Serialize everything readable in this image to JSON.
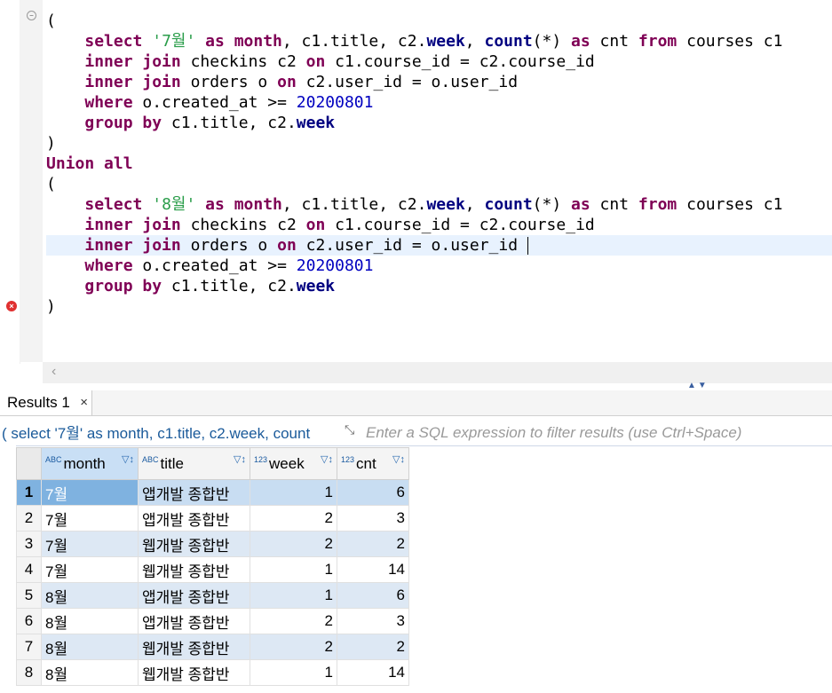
{
  "editor": {
    "lines": [
      {
        "parts": [
          [
            "p",
            "("
          ]
        ]
      },
      {
        "parts": [
          [
            "p",
            "    "
          ],
          [
            "kw",
            "select"
          ],
          [
            "p",
            " "
          ],
          [
            "str",
            "'7월'"
          ],
          [
            "p",
            " "
          ],
          [
            "kw",
            "as"
          ],
          [
            "p",
            " "
          ],
          [
            "kw",
            "month"
          ],
          [
            "p",
            ", c1.title, c2."
          ],
          [
            "fn",
            "week"
          ],
          [
            "p",
            ", "
          ],
          [
            "fn",
            "count"
          ],
          [
            "p",
            "(*) "
          ],
          [
            "kw",
            "as"
          ],
          [
            "p",
            " cnt "
          ],
          [
            "kw",
            "from"
          ],
          [
            "p",
            " courses c1"
          ]
        ]
      },
      {
        "parts": [
          [
            "p",
            "    "
          ],
          [
            "kw",
            "inner join"
          ],
          [
            "p",
            " checkins c2 "
          ],
          [
            "kw",
            "on"
          ],
          [
            "p",
            " c1.course_id = c2.course_id"
          ]
        ]
      },
      {
        "parts": [
          [
            "p",
            "    "
          ],
          [
            "kw",
            "inner join"
          ],
          [
            "p",
            " orders o "
          ],
          [
            "kw",
            "on"
          ],
          [
            "p",
            " c2.user_id = o.user_id"
          ]
        ]
      },
      {
        "parts": [
          [
            "p",
            "    "
          ],
          [
            "kw",
            "where"
          ],
          [
            "p",
            " o.created_at >= "
          ],
          [
            "num",
            "20200801"
          ]
        ]
      },
      {
        "parts": [
          [
            "p",
            "    "
          ],
          [
            "kw",
            "group by"
          ],
          [
            "p",
            " c1.title, c2."
          ],
          [
            "fn",
            "week"
          ]
        ]
      },
      {
        "parts": [
          [
            "p",
            ")"
          ]
        ]
      },
      {
        "parts": [
          [
            "kw",
            "Union all"
          ]
        ]
      },
      {
        "parts": [
          [
            "p",
            "("
          ]
        ]
      },
      {
        "parts": [
          [
            "p",
            "    "
          ],
          [
            "kw",
            "select"
          ],
          [
            "p",
            " "
          ],
          [
            "str",
            "'8월'"
          ],
          [
            "p",
            " "
          ],
          [
            "kw",
            "as"
          ],
          [
            "p",
            " "
          ],
          [
            "kw",
            "month"
          ],
          [
            "p",
            ", c1.title, c2."
          ],
          [
            "fn",
            "week"
          ],
          [
            "p",
            ", "
          ],
          [
            "fn",
            "count"
          ],
          [
            "p",
            "(*) "
          ],
          [
            "kw",
            "as"
          ],
          [
            "p",
            " cnt "
          ],
          [
            "kw",
            "from"
          ],
          [
            "p",
            " courses c1"
          ]
        ]
      },
      {
        "parts": [
          [
            "p",
            "    "
          ],
          [
            "kw",
            "inner join"
          ],
          [
            "p",
            " checkins c2 "
          ],
          [
            "kw",
            "on"
          ],
          [
            "p",
            " c1.course_id = c2.course_id"
          ]
        ]
      },
      {
        "parts": [
          [
            "p",
            "    "
          ],
          [
            "kw",
            "inner join"
          ],
          [
            "p",
            " orders o "
          ],
          [
            "kw",
            "on"
          ],
          [
            "p",
            " c2.user_id = o.user_id "
          ]
        ],
        "current": true
      },
      {
        "parts": [
          [
            "p",
            "    "
          ],
          [
            "kw",
            "where"
          ],
          [
            "p",
            " o.created_at >= "
          ],
          [
            "num",
            "20200801"
          ]
        ]
      },
      {
        "parts": [
          [
            "p",
            "    "
          ],
          [
            "kw",
            "group by"
          ],
          [
            "p",
            " c1.title, c2."
          ],
          [
            "fn",
            "week"
          ]
        ]
      },
      {
        "parts": [
          [
            "p",
            ")"
          ]
        ]
      }
    ]
  },
  "results": {
    "tab_label": "Results 1",
    "close_glyph": "×",
    "query_preview": "( select '7월' as month, c1.title, c2.week, count",
    "filter_placeholder": "Enter a SQL expression to filter results (use Ctrl+Space)",
    "columns": [
      {
        "type": "ABC",
        "name": "month"
      },
      {
        "type": "ABC",
        "name": "title"
      },
      {
        "type": "123",
        "name": "week"
      },
      {
        "type": "123",
        "name": "cnt"
      }
    ],
    "rows": [
      {
        "n": "1",
        "month": "7월",
        "title": "앱개발 종합반",
        "week": "1",
        "cnt": "6"
      },
      {
        "n": "2",
        "month": "7월",
        "title": "앱개발 종합반",
        "week": "2",
        "cnt": "3"
      },
      {
        "n": "3",
        "month": "7월",
        "title": "웹개발 종합반",
        "week": "2",
        "cnt": "2"
      },
      {
        "n": "4",
        "month": "7월",
        "title": "웹개발 종합반",
        "week": "1",
        "cnt": "14"
      },
      {
        "n": "5",
        "month": "8월",
        "title": "앱개발 종합반",
        "week": "1",
        "cnt": "6"
      },
      {
        "n": "6",
        "month": "8월",
        "title": "앱개발 종합반",
        "week": "2",
        "cnt": "3"
      },
      {
        "n": "7",
        "month": "8월",
        "title": "웹개발 종합반",
        "week": "2",
        "cnt": "2"
      },
      {
        "n": "8",
        "month": "8월",
        "title": "웹개발 종합반",
        "week": "1",
        "cnt": "14"
      }
    ]
  }
}
